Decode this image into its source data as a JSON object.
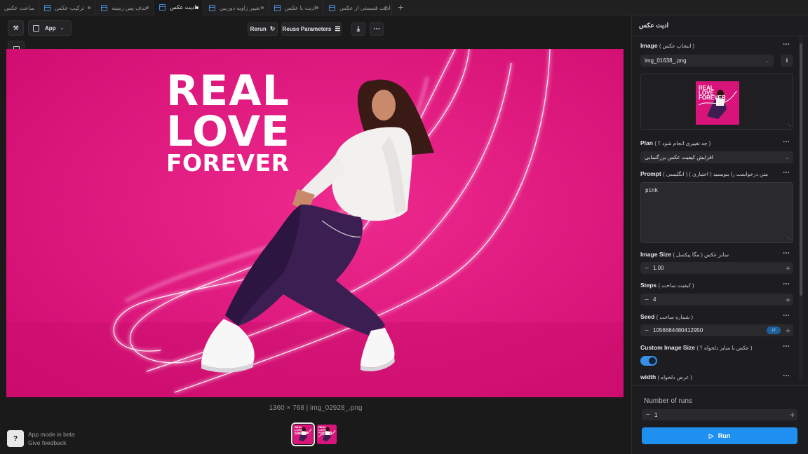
{
  "tabs": [
    {
      "label": "ساخت عکس",
      "active": false
    },
    {
      "label": "ترکیب عکس",
      "active": false
    },
    {
      "label": "حذف پس زمینه",
      "active": false
    },
    {
      "label": "ادیت عکس",
      "active": true
    },
    {
      "label": "تغییر زاویه دوربین",
      "active": false
    },
    {
      "label": "ادیت با عکس",
      "active": false
    },
    {
      "label": "ادیت قسمتی از عکس",
      "active": false
    }
  ],
  "toolbar": {
    "app_label": "App",
    "rerun_label": "Rerun",
    "reuse_label": "Reuse Parameters"
  },
  "image": {
    "headline": [
      "REAL",
      "LOVE",
      "FOREVER"
    ],
    "caption": "1360 × 768 | img_02928_.png",
    "thumb_text": "REAL LOVE FOREVER"
  },
  "beta": {
    "line1": "App mode in beta",
    "line2": "Give feedback"
  },
  "panel": {
    "title": "ادیت عکس",
    "image_label": "Image",
    "image_sub": "( انتخاب عکس )",
    "image_file": "img_01638_.png",
    "plan_label": "Plan",
    "plan_sub": "( چه تغییری انجام شود ؟ )",
    "plan_value": "افزایش کیفیت عکس بزرگنمایی",
    "prompt_label": "Prompt",
    "prompt_sub": "( انگلیسی ) ( اختیاری ) متن درخواست را بنویسید",
    "prompt_value": "pink",
    "size_label": "Image Size",
    "size_sub": "سایز عکس ( مگا پیکسل )",
    "size_value": "1.00",
    "steps_label": "Steps",
    "steps_sub": "( کیفیت ساخت )",
    "steps_value": "4",
    "seed_label": "Seed",
    "seed_sub": "( شماره ساخت )",
    "seed_value": "1056684480412950",
    "custom_label": "Custom Image Size",
    "custom_sub": "( عکس با سایز دلخواه ؟ )",
    "custom_on": true,
    "width_label": "width",
    "width_sub": "( عرض دلخواه )"
  },
  "footer": {
    "runs_label": "Number of runs",
    "runs_value": "1",
    "run_label": "Run"
  },
  "colors": {
    "accent": "#1f8ff0",
    "background_pink": "#e0127c"
  }
}
